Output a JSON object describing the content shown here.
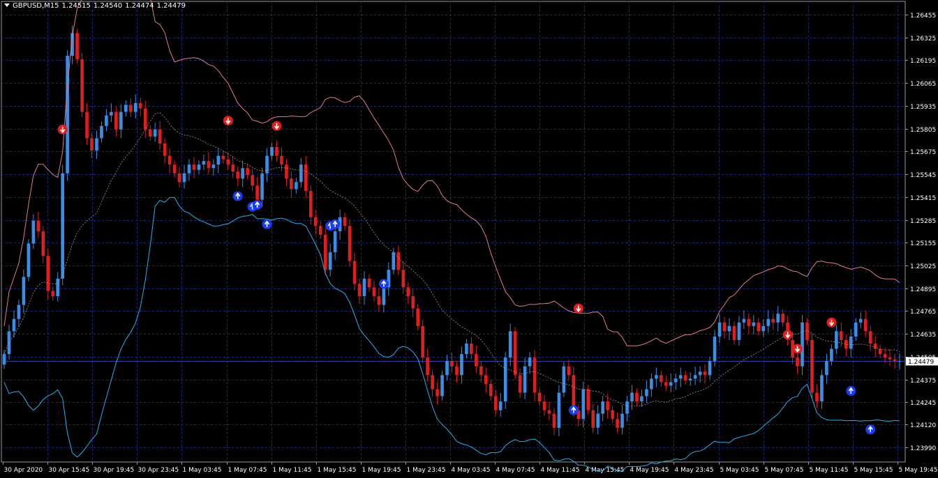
{
  "header": {
    "symbol": "GBPUSD,M15",
    "open": "1.24515",
    "high": "1.24540",
    "low": "1.24474",
    "close": "1.24479"
  },
  "colors": {
    "background": "#000000",
    "grid": "#1e2c6e",
    "bull": "#3a8ee6",
    "bear": "#e01e1e",
    "upper_band": "#e07c8c",
    "lower_band": "#28b0ee",
    "mid_band": "#9a9a9a",
    "axis_text": "#ffffff",
    "price_label_bg": "#ffffff",
    "price_label_text": "#000000",
    "current_price_line": "#2e3f9c",
    "sell_signal": "#e01e1e",
    "buy_signal": "#1a3cf0"
  },
  "chart_data": {
    "type": "candlestick",
    "title": "GBPUSD,M15",
    "ylim": [
      1.23905,
      1.2653
    ],
    "yticks": [
      "1.26455",
      "1.26325",
      "1.26195",
      "1.26065",
      "1.25935",
      "1.25805",
      "1.25675",
      "1.25545",
      "1.25415",
      "1.25285",
      "1.25155",
      "1.25025",
      "1.24895",
      "1.24765",
      "1.24635",
      "1.24505",
      "1.24375",
      "1.24245",
      "1.24120",
      "1.23990"
    ],
    "xticks": [
      "30 Apr 2020",
      "30 Apr 15:45",
      "30 Apr 19:45",
      "30 Apr 23:45",
      "1 May 03:45",
      "1 May 07:45",
      "1 May 11:45",
      "1 May 15:45",
      "1 May 19:45",
      "1 May 23:45",
      "4 May 03:45",
      "4 May 07:45",
      "4 May 11:45",
      "4 May 15:45",
      "4 May 19:45",
      "4 May 23:45",
      "5 May 03:45",
      "5 May 07:45",
      "5 May 11:45",
      "5 May 15:45",
      "5 May 19:45"
    ],
    "current_price": "1.24479",
    "grid": true,
    "series": [
      {
        "kind": "candles",
        "close_path": [
          1.2452,
          1.2465,
          1.2472,
          1.248,
          1.2496,
          1.2515,
          1.2528,
          1.2522,
          1.2508,
          1.2488,
          1.2485,
          1.2495,
          1.2555,
          1.2622,
          1.2635,
          1.262,
          1.259,
          1.2575,
          1.2568,
          1.2575,
          1.2582,
          1.2588,
          1.259,
          1.258,
          1.259,
          1.2594,
          1.259,
          1.2595,
          1.2592,
          1.258,
          1.2576,
          1.258,
          1.2572,
          1.2565,
          1.256,
          1.2555,
          1.255,
          1.2555,
          1.256,
          1.2557,
          1.256,
          1.2562,
          1.2558,
          1.256,
          1.2565,
          1.2563,
          1.256,
          1.2556,
          1.2552,
          1.2558,
          1.2554,
          1.2548,
          1.254,
          1.2555,
          1.2565,
          1.257,
          1.2565,
          1.256,
          1.2552,
          1.2546,
          1.255,
          1.256,
          1.2545,
          1.253,
          1.2525,
          1.252,
          1.25,
          1.251,
          1.2522,
          1.253,
          1.2525,
          1.2505,
          1.2492,
          1.2485,
          1.2495,
          1.249,
          1.2485,
          1.248,
          1.249,
          1.25,
          1.251,
          1.25,
          1.249,
          1.2485,
          1.2478,
          1.2468,
          1.245,
          1.244,
          1.2432,
          1.2428,
          1.244,
          1.2448,
          1.2445,
          1.244,
          1.2452,
          1.2458,
          1.2452,
          1.2445,
          1.244,
          1.2435,
          1.2428,
          1.242,
          1.2425,
          1.245,
          1.2465,
          1.244,
          1.243,
          1.2445,
          1.245,
          1.243,
          1.2425,
          1.242,
          1.2418,
          1.241,
          1.243,
          1.2445,
          1.244,
          1.242,
          1.2415,
          1.2432,
          1.242,
          1.241,
          1.2418,
          1.2425,
          1.242,
          1.2415,
          1.241,
          1.2418,
          1.2425,
          1.243,
          1.2425,
          1.2428,
          1.2432,
          1.2438,
          1.244,
          1.2436,
          1.2434,
          1.2436,
          1.2438,
          1.244,
          1.2437,
          1.2438,
          1.244,
          1.2442,
          1.244,
          1.2448,
          1.2462,
          1.247,
          1.2465,
          1.2468,
          1.246,
          1.247,
          1.2472,
          1.2468,
          1.247,
          1.2465,
          1.2468,
          1.2472,
          1.247,
          1.2475,
          1.247,
          1.246,
          1.245,
          1.2445,
          1.247,
          1.246,
          1.243,
          1.2425,
          1.244,
          1.2448,
          1.2455,
          1.2465,
          1.246,
          1.2455,
          1.2462,
          1.247,
          1.2472,
          1.2465,
          1.2458,
          1.2455,
          1.2452,
          1.245,
          1.2449,
          1.2448,
          1.2448
        ]
      },
      {
        "kind": "upper_band",
        "name": ""
      },
      {
        "kind": "middle_band",
        "name": ""
      },
      {
        "kind": "lower_band",
        "name": ""
      }
    ],
    "signals": {
      "sell": [
        1.258,
        1.2585,
        1.2582,
        1.2478,
        1.2463,
        1.2455,
        1.247
      ],
      "buy": [
        1.2542,
        1.2536,
        1.2537,
        1.2526,
        1.2525,
        1.2526,
        1.2492,
        1.242,
        1.2431,
        1.2409
      ]
    }
  }
}
